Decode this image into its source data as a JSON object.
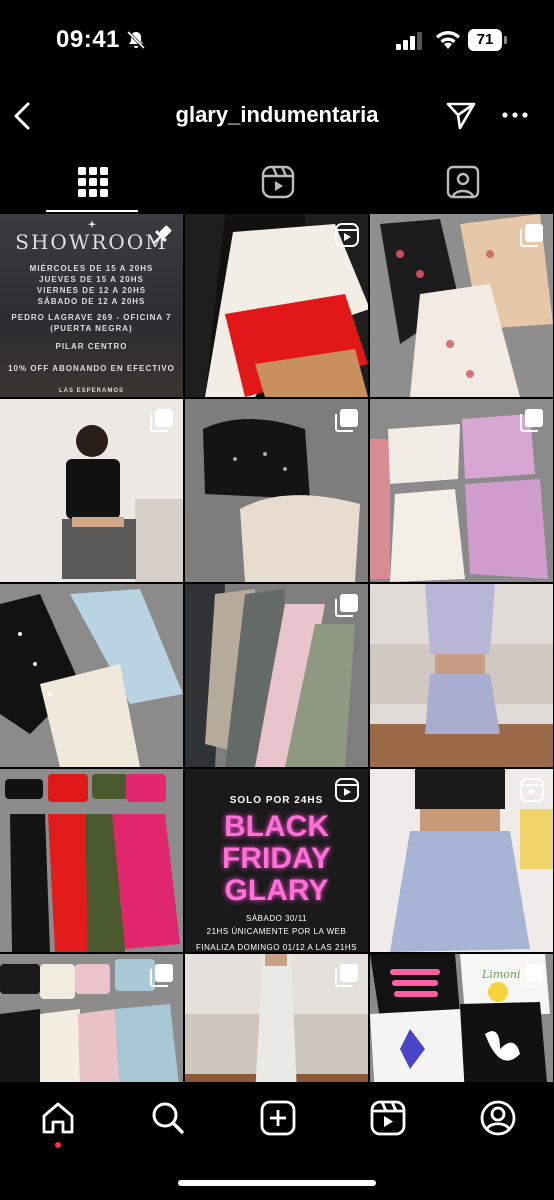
{
  "status": {
    "time": "09:41",
    "battery": "71"
  },
  "header": {
    "username": "glary_indumentaria"
  },
  "tabs": [
    "grid",
    "reels",
    "tagged"
  ],
  "posts": [
    {
      "type": "pinned",
      "showroom": {
        "title": "SHOWROOM",
        "lines": [
          "MIÉRCOLES DE 15 A 20HS",
          "JUEVES DE 15 A 20HS",
          "VIERNES DE 12 A 20HS",
          "SÁBADO DE 12 A 20HS"
        ],
        "address": "PEDRO LAGRAVE 269 - OFICINA 7",
        "address_note": "(PUERTA NEGRA)",
        "location": "PILAR CENTRO",
        "promo": "10% OFF ABONANDO EN EFECTIVO",
        "footer": "LAS ESPERAMOS"
      }
    },
    {
      "type": "reel"
    },
    {
      "type": "carousel"
    },
    {
      "type": "carousel"
    },
    {
      "type": "carousel"
    },
    {
      "type": "carousel"
    },
    {
      "type": "none"
    },
    {
      "type": "carousel"
    },
    {
      "type": "none"
    },
    {
      "type": "carousel"
    },
    {
      "type": "reel",
      "promo": {
        "top": "SOLO POR 24HS",
        "line1": "BLACK",
        "line2": "FRIDAY",
        "line3": "GLARY",
        "date": "SÁBADO 30/11",
        "web": "21HS ÚNICAMENTE POR LA WEB",
        "end": "FINALIZA DOMINGO 01/12 A LAS 21HS"
      }
    },
    {
      "type": "reel"
    },
    {
      "type": "carousel"
    },
    {
      "type": "carousel"
    },
    {
      "type": "carousel",
      "tee_text": "Limoni"
    }
  ],
  "bottom_nav": [
    "home",
    "search",
    "create",
    "reels",
    "profile"
  ]
}
